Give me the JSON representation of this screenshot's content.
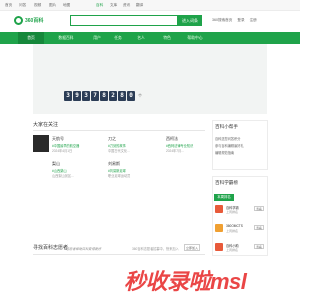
{
  "topnav": {
    "items": [
      "首页",
      "问答",
      "视频",
      "图片",
      "地图",
      "百科",
      "文库",
      "资讯",
      "翻译"
    ],
    "active_index": 6
  },
  "header": {
    "logo_text": "360百科",
    "search_placeholder": "",
    "search_button": "进入词条",
    "links": [
      "360搜索首页",
      "登录",
      "注册"
    ]
  },
  "mainnav": {
    "tabs": [
      "首页",
      "数据百科",
      "用户",
      "任务",
      "名人",
      "特色",
      "帮助中心"
    ],
    "active_index": 0
  },
  "counter": {
    "digits": [
      "3",
      "9",
      "3",
      "7",
      "8",
      "2",
      "8",
      "0"
    ],
    "unit": "个"
  },
  "follow": {
    "title": "大家在关注",
    "cards": [
      {
        "title": "天航号",
        "tag": "#中国最早的航空器",
        "meta": "2024年4月1日"
      },
      {
        "title": "刀之",
        "tag": "#刀剑的故事",
        "meta": "中国古代文化..."
      },
      {
        "title": "西柯法",
        "tag": "#西柯法律专业知识",
        "meta": "2024年7月..."
      },
      {
        "title": "梨山",
        "tag": "#山西梨山",
        "meta": "山西梨山景区..."
      },
      {
        "title": "刘易斯",
        "tag": "#刘易斯足球",
        "meta": "职业足球运动员"
      }
    ]
  },
  "sidebar": {
    "help": {
      "title": "百科小帮手",
      "lines": [
        "百科送您问答积分",
        "参与百科编辑赢好礼",
        "编辑规范指南"
      ]
    },
    "science": {
      "title": "百科学霸榜",
      "tab_label": "本周排名",
      "items": [
        {
          "title": "百科学霸",
          "sub": "上周排名",
          "button": "查看"
        },
        {
          "title": "360OMCTS",
          "sub": "上周排名",
          "button": "查看"
        },
        {
          "title": "百科小助",
          "sub": "上周排名",
          "button": "查看"
        }
      ]
    }
  },
  "volunteer": {
    "title": "寻找百科志愿者",
    "desc": "志愿者帮助百科变得更好",
    "note": "360百科志愿者招募中，快来加入",
    "button": "立即加入"
  },
  "watermark": "秒收录啦msl"
}
